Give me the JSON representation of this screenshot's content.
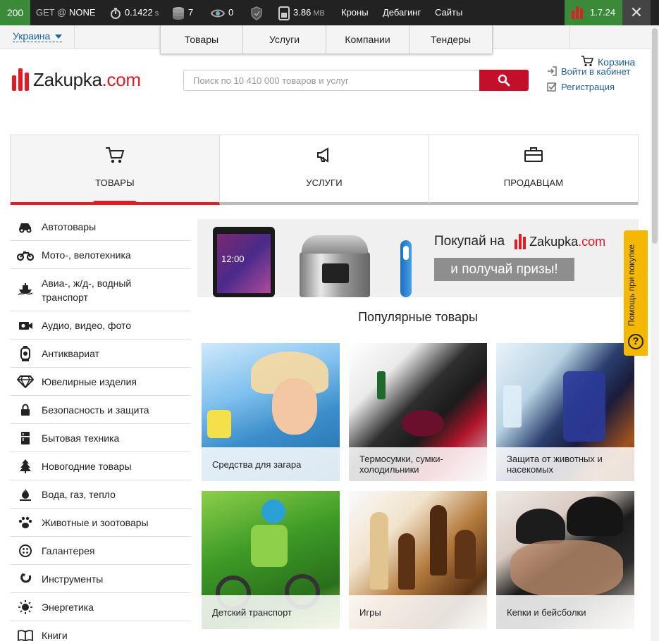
{
  "debug": {
    "status": "200",
    "request_method": "GET @",
    "request_route": "NONE",
    "time": "0.1422",
    "time_unit": "s",
    "db_queries": "7",
    "requests": "0",
    "memory": "3.86",
    "memory_unit": "MB",
    "links": [
      "Кроны",
      "Дебагинг",
      "Сайты"
    ],
    "version": "1.7.24",
    "close": "✕"
  },
  "topnav": {
    "region": "Украина",
    "tabs": [
      "Товары",
      "Услуги",
      "Компании",
      "Тендеры"
    ],
    "cart": "Корзина"
  },
  "header": {
    "logo_name": "Zakupka",
    "logo_domain": ".com",
    "search_placeholder": "Поиск по 10 410 000 товаров и услуг",
    "login": "Войти в кабинет",
    "register": "Регистрация"
  },
  "big_tabs": [
    {
      "label": "ТОВАРЫ",
      "icon": "cart-icon",
      "active": true
    },
    {
      "label": "УСЛУГИ",
      "icon": "megaphone-icon",
      "active": false
    },
    {
      "label": "ПРОДАВЦАМ",
      "icon": "briefcase-icon",
      "active": false
    }
  ],
  "categories": [
    {
      "label": "Автотовары",
      "icon": "car-icon"
    },
    {
      "label": "Мото-, велотехника",
      "icon": "motorcycle-icon"
    },
    {
      "label": "Авиа-, ж/д-, водный транспорт",
      "icon": "ship-icon"
    },
    {
      "label": "Аудио, видео, фото",
      "icon": "camera-icon"
    },
    {
      "label": "Антиквариат",
      "icon": "lantern-icon"
    },
    {
      "label": "Ювелирные изделия",
      "icon": "diamond-icon"
    },
    {
      "label": "Безопасность и защита",
      "icon": "lock-icon"
    },
    {
      "label": "Бытовая техника",
      "icon": "fridge-icon"
    },
    {
      "label": "Новогодние товары",
      "icon": "fir-tree-icon"
    },
    {
      "label": "Вода, газ, тепло",
      "icon": "flame-icon"
    },
    {
      "label": "Животные и зоотовары",
      "icon": "paw-icon"
    },
    {
      "label": "Галантерея",
      "icon": "button-icon"
    },
    {
      "label": "Инструменты",
      "icon": "wrench-icon"
    },
    {
      "label": "Энергетика",
      "icon": "sun-icon"
    },
    {
      "label": "Книги",
      "icon": "book-icon"
    }
  ],
  "banner": {
    "line1": "Покупай на",
    "brand_name": "Zakupka",
    "brand_domain": ".com",
    "line2": "и получай призы!",
    "tablet_time": "12:00"
  },
  "popular": {
    "title": "Популярные товары",
    "items": [
      {
        "label": "Средства для загара"
      },
      {
        "label": "Термосумки, сумки-холодильники"
      },
      {
        "label": "Защита от животных и насекомых"
      },
      {
        "label": "Детский транспорт"
      },
      {
        "label": "Игры"
      },
      {
        "label": "Кепки и бейсболки"
      }
    ]
  },
  "help": {
    "label": "Помощь при покупке",
    "q": "?"
  },
  "colors": {
    "brand_red": "#e41b23",
    "link_blue": "#1f5fa0",
    "debug_green": "#3a8a3a",
    "help_yellow": "#f5b800"
  }
}
